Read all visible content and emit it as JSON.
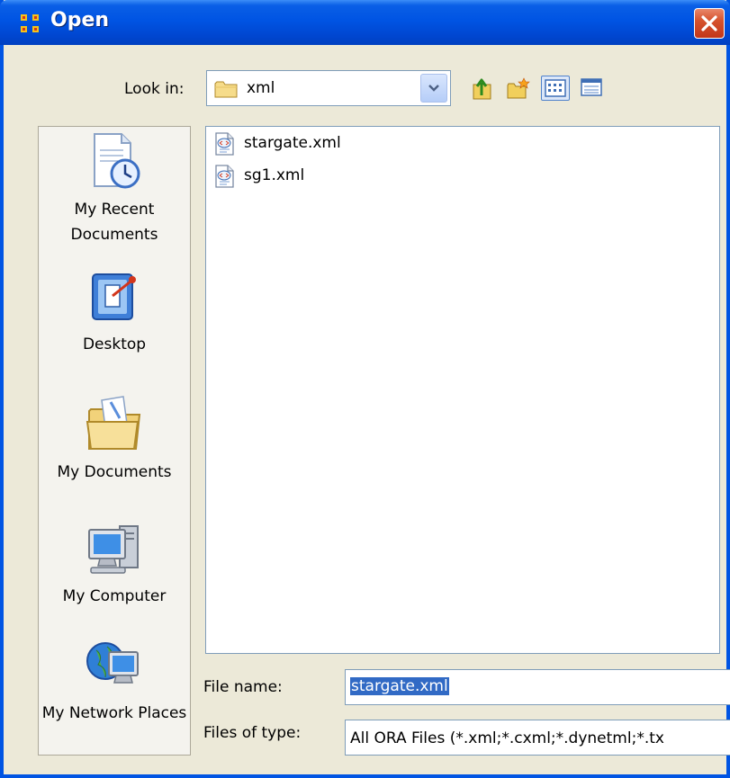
{
  "window": {
    "title": "Open"
  },
  "toolbar": {
    "look_in_label": "Look in:",
    "look_in_value": "xml",
    "buttons": [
      "up-one-level-icon",
      "new-folder-icon",
      "list-view-icon",
      "details-view-icon"
    ]
  },
  "places": {
    "recent": "My Recent Documents",
    "desktop": "Desktop",
    "documents": "My Documents",
    "computer": "My Computer",
    "network": "My Network Places"
  },
  "files": [
    {
      "name": "stargate.xml",
      "icon": "xml-file-icon"
    },
    {
      "name": "sg1.xml",
      "icon": "xml-file-icon"
    }
  ],
  "form": {
    "file_name_label": "File name:",
    "file_name_value": "stargate.xml",
    "files_of_type_label": "Files of type:",
    "files_of_type_value": "All ORA Files (*.xml;*.cxml;*.dynetml;*.tx"
  },
  "colors": {
    "titlebar": "#0054e3",
    "close_button": "#d6532e",
    "dialog_bg": "#ece9d8",
    "selection": "#316ac5"
  }
}
